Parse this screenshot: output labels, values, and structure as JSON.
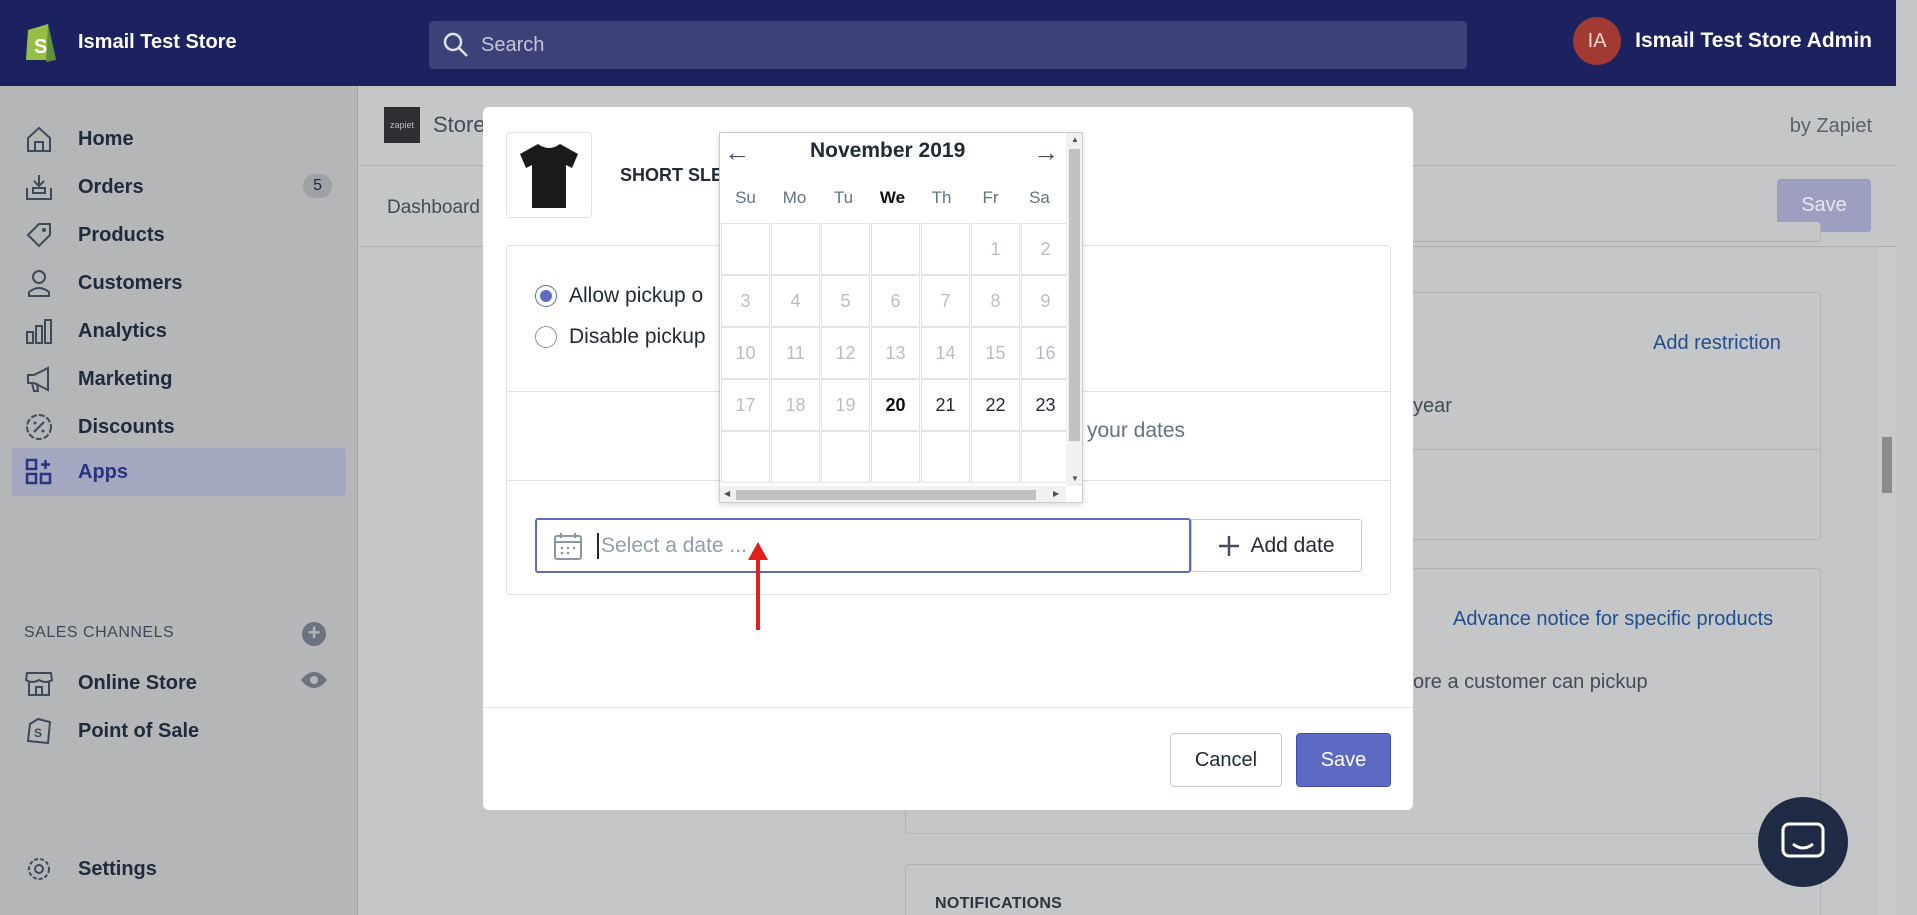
{
  "topbar": {
    "store_name": "Ismail Test Store",
    "search_placeholder": "Search",
    "avatar_initials": "IA",
    "account_name": "Ismail Test Store Admin"
  },
  "sidebar": {
    "items": [
      {
        "label": "Home",
        "icon": "home-icon"
      },
      {
        "label": "Orders",
        "icon": "orders-icon",
        "badge": "5"
      },
      {
        "label": "Products",
        "icon": "tag-icon"
      },
      {
        "label": "Customers",
        "icon": "person-icon"
      },
      {
        "label": "Analytics",
        "icon": "bar-chart-icon"
      },
      {
        "label": "Marketing",
        "icon": "megaphone-icon"
      },
      {
        "label": "Discounts",
        "icon": "discount-icon"
      },
      {
        "label": "Apps",
        "icon": "apps-icon"
      }
    ],
    "sales_channels_label": "SALES CHANNELS",
    "channels": [
      {
        "label": "Online Store",
        "icon": "store-icon"
      },
      {
        "label": "Point of Sale",
        "icon": "pos-icon"
      }
    ],
    "settings_label": "Settings"
  },
  "app": {
    "logo_text": "zapiet",
    "title": "Store",
    "by": "by Zapiet",
    "tab_dashboard": "Dashboard",
    "save_label": "Save",
    "add_restriction": "Add restriction",
    "year_text": "year",
    "advance_notice_link": "Advance notice for specific products",
    "pickup_text": "ore a customer can pickup",
    "notifications": "NOTIFICATIONS"
  },
  "modal": {
    "product_name": "SHORT SLE",
    "radio_allow": "Allow pickup o",
    "radio_disable": "Disable pickup",
    "dates_text": "your dates",
    "date_placeholder": "Select a date ...",
    "add_date_label": "Add date",
    "cancel_label": "Cancel",
    "save_label": "Save"
  },
  "datepicker": {
    "month": "November 2019",
    "weekdays": [
      "Su",
      "Mo",
      "Tu",
      "We",
      "Th",
      "Fr",
      "Sa"
    ],
    "today_weekday_index": 3,
    "weeks": [
      [
        "",
        "",
        "",
        "",
        "",
        "1",
        "2"
      ],
      [
        "3",
        "4",
        "5",
        "6",
        "7",
        "8",
        "9"
      ],
      [
        "10",
        "11",
        "12",
        "13",
        "14",
        "15",
        "16"
      ],
      [
        "17",
        "18",
        "19",
        "20",
        "21",
        "22",
        "23"
      ]
    ],
    "today": "20",
    "first_active": "20"
  }
}
